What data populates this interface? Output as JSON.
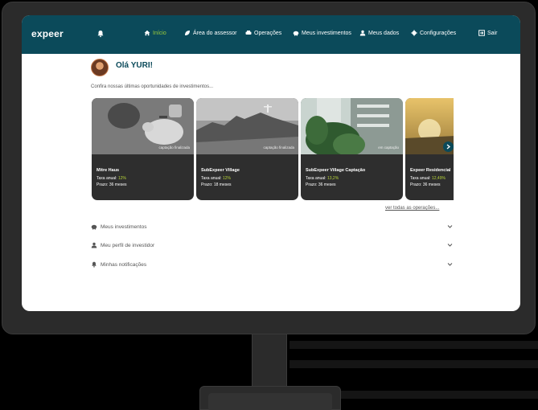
{
  "brand": {
    "logo_text": "expeer"
  },
  "nav": {
    "items": [
      {
        "label": "Início",
        "icon": "home-icon",
        "active": true
      },
      {
        "label": "Área do assessor",
        "icon": "leaf-icon"
      },
      {
        "label": "Operações",
        "icon": "handshake-icon"
      },
      {
        "label": "Meus investimentos",
        "icon": "piggy-bank-icon"
      },
      {
        "label": "Meus dados",
        "icon": "user-icon"
      },
      {
        "label": "Configurações",
        "icon": "gear-icon"
      },
      {
        "label": "Sair",
        "icon": "logout-icon"
      }
    ]
  },
  "greeting": {
    "text": "Olá YURI!"
  },
  "intro": "Confira nossas últimas oportunidades de investimentos...",
  "opportunities": [
    {
      "title": "Mitre Haus",
      "status": "captação finalizada",
      "rate_label": "Taxa anual:",
      "rate": "12%",
      "term": "Prazo: 36 meses"
    },
    {
      "title": "SubExpeer Village",
      "status": "captação finalizada",
      "rate_label": "Taxa anual:",
      "rate": "12%",
      "term": "Prazo: 18 meses"
    },
    {
      "title": "SubExpeer Village Captação",
      "status": "em captação",
      "rate_label": "Taxa anual:",
      "rate": "13,2%",
      "term": "Prazo: 36 meses"
    },
    {
      "title": "Expeer Residencial",
      "status": "",
      "rate_label": "Taxa anual:",
      "rate": "12,49%",
      "term": "Prazo: 36 meses"
    }
  ],
  "see_all": "ver todas as operações...",
  "accordions": [
    {
      "label": "Meus investimentos",
      "icon": "piggy-bank-icon"
    },
    {
      "label": "Meu perfil de investidor",
      "icon": "user-icon"
    },
    {
      "label": "Minhas notificações",
      "icon": "bell-icon"
    }
  ],
  "colors": {
    "nav_bg": "#0b4a5a",
    "accent": "#9ccc3a",
    "card_bg": "#2e2e2e"
  }
}
